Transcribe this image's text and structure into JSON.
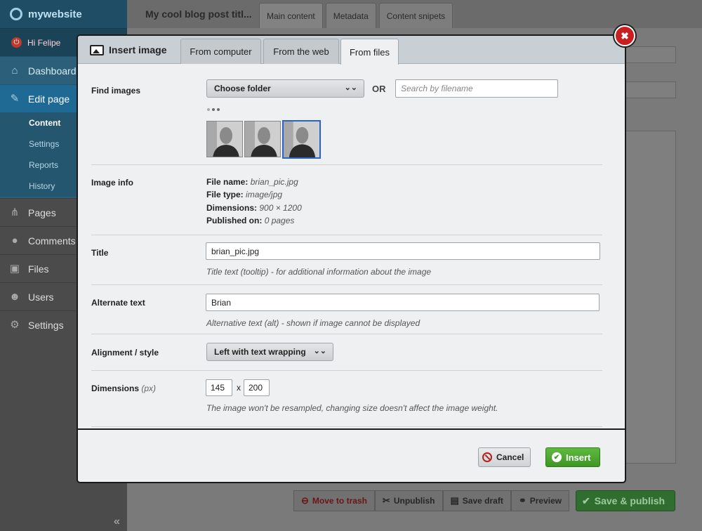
{
  "sidebar": {
    "brand": "mywebsite",
    "greeting": "Hi Felipe",
    "items": [
      {
        "label": "Dashboard",
        "icon": "home-icon"
      },
      {
        "label": "Edit page",
        "icon": "pencil-icon"
      },
      {
        "label": "Pages",
        "icon": "sitemap-icon"
      },
      {
        "label": "Comments",
        "icon": "comment-icon"
      },
      {
        "label": "Files",
        "icon": "image-icon"
      },
      {
        "label": "Users",
        "icon": "users-icon"
      },
      {
        "label": "Settings",
        "icon": "gear-icon"
      }
    ],
    "subitems": [
      "Content",
      "Settings",
      "Reports",
      "History"
    ],
    "collapse": "«"
  },
  "main": {
    "page_title": "My cool blog post titl...",
    "tabs": [
      "Main content",
      "Metadata",
      "Content snipets"
    ]
  },
  "bottom_bar": {
    "trash": "Move to trash",
    "unpublish": "Unpublish",
    "save_draft": "Save draft",
    "preview": "Preview",
    "publish": "Save & publish"
  },
  "modal": {
    "title": "Insert image",
    "tabs": [
      "From computer",
      "From the web",
      "From files"
    ],
    "active_tab": "From files",
    "find_images": {
      "label": "Find images",
      "folder_select": "Choose folder",
      "or": "OR",
      "search_placeholder": "Search by filename"
    },
    "image_info": {
      "label": "Image info",
      "file_name_label": "File name:",
      "file_name": "brian_pic.jpg",
      "file_type_label": "File type:",
      "file_type": "image/jpg",
      "dimensions_label": "Dimensions:",
      "dimensions": "900 × 1200",
      "published_label": "Published on:",
      "published": "0 pages"
    },
    "title_field": {
      "label": "Title",
      "value": "brian_pic.jpg",
      "hint": "Title text (tooltip) - for additional information about the image"
    },
    "alt_field": {
      "label": "Alternate text",
      "value": "Brian",
      "hint": "Alternative text (alt) - shown if image cannot be displayed"
    },
    "alignment": {
      "label": "Alignment / style",
      "value": "Left with text wrapping"
    },
    "dimensions": {
      "label": "Dimensions",
      "unit": "(px)",
      "width": "145",
      "x": "x",
      "height": "200",
      "hint": "The image won't be resampled, changing size doesn't affect the image weight."
    },
    "cancel": "Cancel",
    "insert": "Insert",
    "close": "✖"
  },
  "colors": {
    "accent": "#2a64c8",
    "insert_green": "#3e9626",
    "close_red": "#c91f1f"
  }
}
